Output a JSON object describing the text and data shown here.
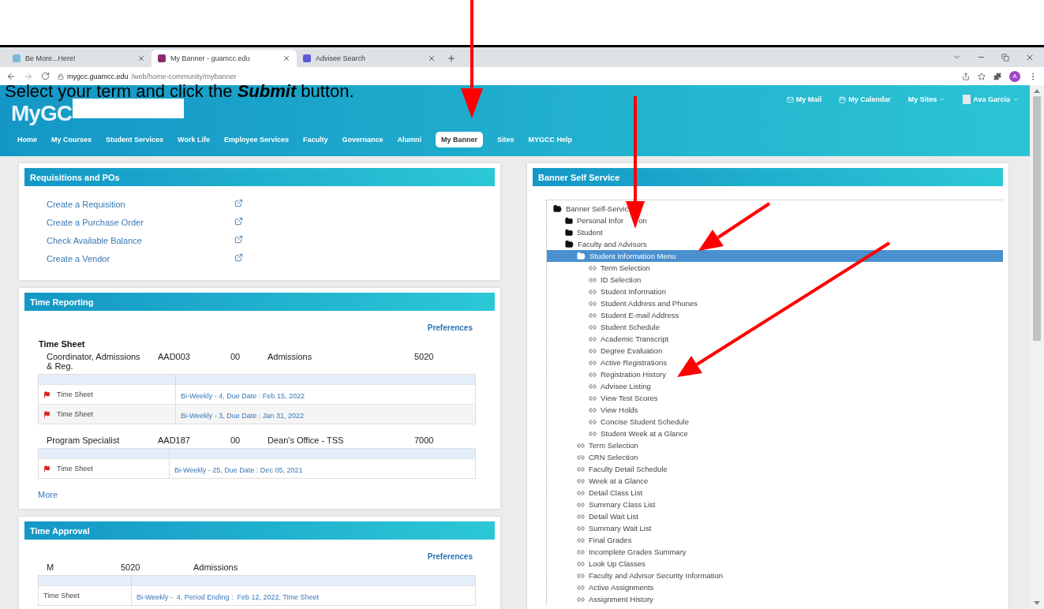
{
  "browser": {
    "tabs": [
      {
        "title": "Be More...Here!",
        "selected": false
      },
      {
        "title": "My Banner - guamcc.edu",
        "selected": true
      },
      {
        "title": "Advisee Search",
        "selected": false
      }
    ],
    "url_host": "mygcc.guamcc.edu",
    "url_path": "/web/home-community/mybanner",
    "profile_initial": "A"
  },
  "caption": "Select your term and click the **Submit** button.",
  "header": {
    "logo": "MyGC",
    "links": [
      {
        "label": "My Mail",
        "kind": "mail"
      },
      {
        "label": "My Calendar",
        "kind": "calendar"
      },
      {
        "label": "My Sites",
        "kind": "menu"
      },
      {
        "label": "Ava Garcia",
        "kind": "user"
      }
    ],
    "nav": [
      {
        "label": "Home",
        "selected": false
      },
      {
        "label": "My Courses",
        "selected": false
      },
      {
        "label": "Student Services",
        "selected": false
      },
      {
        "label": "Work Life",
        "selected": false
      },
      {
        "label": "Employee Services",
        "selected": false
      },
      {
        "label": "Faculty",
        "selected": false
      },
      {
        "label": "Governance",
        "selected": false
      },
      {
        "label": "Alumni",
        "selected": false
      },
      {
        "label": "My Banner",
        "selected": true
      },
      {
        "label": "Sites",
        "selected": false
      },
      {
        "label": "MYGCC Help",
        "selected": false
      }
    ]
  },
  "requisitions": {
    "title": "Requisitions and POs",
    "links": [
      "Create a Requisition",
      "Create a Purchase Order",
      "Check Available Balance",
      "Create a Vendor"
    ]
  },
  "time_reporting": {
    "title": "Time Reporting",
    "preferences": "Preferences",
    "heading": "Time Sheet",
    "jobs": [
      {
        "columns": [
          "Coordinator, Admissions & Reg.",
          "AAD003",
          "00",
          "Admissions",
          "5020"
        ],
        "sheets": [
          {
            "label": "Time Sheet",
            "period": "Bi-Weekly - 4, Due Date : Feb 15, 2022",
            "flagged": true
          },
          {
            "label": "Time Sheet",
            "period": "Bi-Weekly - 3, Due Date : Jan 31, 2022",
            "flagged": true
          }
        ]
      },
      {
        "columns": [
          "Program Specialist",
          "AAD187",
          "00",
          "Dean's Office - TSS",
          "7000"
        ],
        "sheets": [
          {
            "label": "Time Sheet",
            "period": "Bi-Weekly - 25, Due Date : Dec 05, 2021",
            "flagged": true
          }
        ]
      }
    ],
    "more": "More"
  },
  "time_approval": {
    "title": "Time Approval",
    "preferences": "Preferences",
    "groups": [
      {
        "columns": [
          "M",
          "5020",
          "Admissions"
        ],
        "sheets": [
          {
            "label": "Time Sheet",
            "period": "Bi-Weekly -  4, Period Ending :  Feb 12, 2022, Time Sheet",
            "flagged": false
          }
        ]
      }
    ]
  },
  "self_service": {
    "title": "Banner Self Service",
    "tree": [
      {
        "label": "Banner Self-Servic",
        "kind": "folder",
        "expanded": true,
        "selected": false,
        "children": [
          {
            "label": "Personal Infor",
            "tail": "on",
            "kind": "folder",
            "expanded": false,
            "selected": false
          },
          {
            "label": "Student",
            "kind": "folder",
            "expanded": false,
            "selected": false
          },
          {
            "label": "Faculty and Advisors",
            "kind": "folder",
            "expanded": true,
            "selected": false,
            "children": [
              {
                "label": "Student Information Menu",
                "kind": "folder",
                "expanded": true,
                "selected": true,
                "children": [
                  {
                    "label": "Term Selection",
                    "kind": "link",
                    "selected": false
                  },
                  {
                    "label": "ID Selection",
                    "kind": "link",
                    "selected": false
                  },
                  {
                    "label": "Student Information",
                    "kind": "link",
                    "selected": false
                  },
                  {
                    "label": "Student Address and Phones",
                    "kind": "link",
                    "selected": false
                  },
                  {
                    "label": "Student E-mail Address",
                    "kind": "link",
                    "selected": false
                  },
                  {
                    "label": "Student Schedule",
                    "kind": "link",
                    "selected": false
                  },
                  {
                    "label": "Academic Transcript",
                    "kind": "link",
                    "selected": false
                  },
                  {
                    "label": "Degree Evaluation",
                    "kind": "link",
                    "selected": false
                  },
                  {
                    "label": "Active Registrations",
                    "kind": "link",
                    "selected": false
                  },
                  {
                    "label": "Registration History",
                    "kind": "link",
                    "selected": false
                  },
                  {
                    "label": "Advisee Listing",
                    "kind": "link",
                    "selected": false
                  },
                  {
                    "label": "View Test Scores",
                    "kind": "link",
                    "selected": false
                  },
                  {
                    "label": "View Holds",
                    "kind": "link",
                    "selected": false
                  },
                  {
                    "label": "Concise Student Schedule",
                    "kind": "link",
                    "selected": false
                  },
                  {
                    "label": "Student Week at a Glance",
                    "kind": "link",
                    "selected": false
                  }
                ]
              },
              {
                "label": "Term Selection",
                "kind": "link",
                "selected": false
              },
              {
                "label": "CRN Selection",
                "kind": "link",
                "selected": false
              },
              {
                "label": "Faculty Detail Schedule",
                "kind": "link",
                "selected": false
              },
              {
                "label": "Week at a Glance",
                "kind": "link",
                "selected": false
              },
              {
                "label": "Detail Class List",
                "kind": "link",
                "selected": false
              },
              {
                "label": "Summary Class List",
                "kind": "link",
                "selected": false
              },
              {
                "label": "Detail Wait List",
                "kind": "link",
                "selected": false
              },
              {
                "label": "Summary Wait List",
                "kind": "link",
                "selected": false
              },
              {
                "label": "Final Grades",
                "kind": "link",
                "selected": false
              },
              {
                "label": "Incomplete Grades Summary",
                "kind": "link",
                "selected": false
              },
              {
                "label": "Look Up Classes",
                "kind": "link",
                "selected": false
              },
              {
                "label": "Faculty and Advisor Security Information",
                "kind": "link",
                "selected": false
              },
              {
                "label": "Active Assignments",
                "kind": "link",
                "selected": false
              },
              {
                "label": "Assignment History",
                "kind": "link",
                "selected": false
              }
            ]
          }
        ]
      }
    ]
  }
}
